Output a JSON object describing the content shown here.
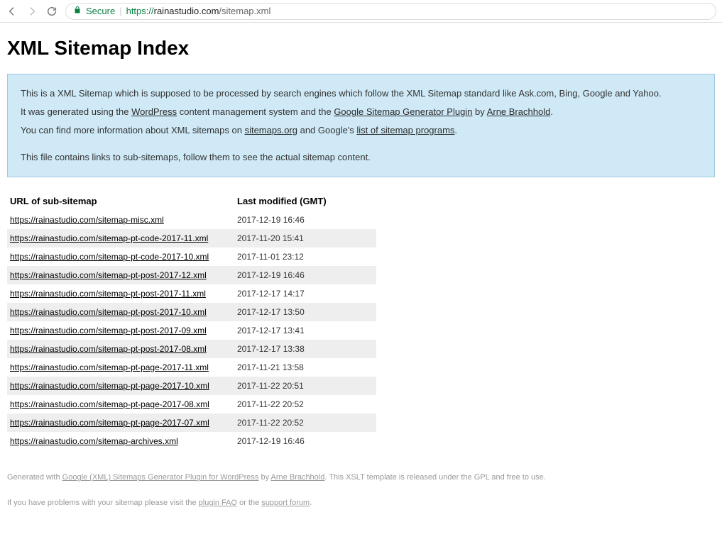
{
  "browser": {
    "secure_label": "Secure",
    "url_proto": "https://",
    "url_host": "rainastudio.com",
    "url_path": "/sitemap.xml"
  },
  "page_title": "XML Sitemap Index",
  "info": {
    "line1_a": "This is a XML Sitemap which is supposed to be processed by search engines which follow the XML Sitemap standard like Ask.com, Bing, Google and Yahoo.",
    "line2_a": "It was generated using the ",
    "line2_link1": "WordPress",
    "line2_b": " content management system and the ",
    "line2_link2": "Google Sitemap Generator Plugin",
    "line2_c": " by ",
    "line2_link3": "Arne Brachhold",
    "line2_d": ".",
    "line3_a": "You can find more information about XML sitemaps on ",
    "line3_link1": "sitemaps.org",
    "line3_b": " and Google's ",
    "line3_link2": "list of sitemap programs",
    "line3_c": ".",
    "line4": "This file contains links to sub-sitemaps, follow them to see the actual sitemap content."
  },
  "table": {
    "header_url": "URL of sub-sitemap",
    "header_date": "Last modified (GMT)",
    "rows": [
      {
        "url": "https://rainastudio.com/sitemap-misc.xml",
        "date": "2017-12-19 16:46"
      },
      {
        "url": "https://rainastudio.com/sitemap-pt-code-2017-11.xml",
        "date": "2017-11-20 15:41"
      },
      {
        "url": "https://rainastudio.com/sitemap-pt-code-2017-10.xml",
        "date": "2017-11-01 23:12"
      },
      {
        "url": "https://rainastudio.com/sitemap-pt-post-2017-12.xml",
        "date": "2017-12-19 16:46"
      },
      {
        "url": "https://rainastudio.com/sitemap-pt-post-2017-11.xml",
        "date": "2017-12-17 14:17"
      },
      {
        "url": "https://rainastudio.com/sitemap-pt-post-2017-10.xml",
        "date": "2017-12-17 13:50"
      },
      {
        "url": "https://rainastudio.com/sitemap-pt-post-2017-09.xml",
        "date": "2017-12-17 13:41"
      },
      {
        "url": "https://rainastudio.com/sitemap-pt-post-2017-08.xml",
        "date": "2017-12-17 13:38"
      },
      {
        "url": "https://rainastudio.com/sitemap-pt-page-2017-11.xml",
        "date": "2017-11-21 13:58"
      },
      {
        "url": "https://rainastudio.com/sitemap-pt-page-2017-10.xml",
        "date": "2017-11-22 20:51"
      },
      {
        "url": "https://rainastudio.com/sitemap-pt-page-2017-08.xml",
        "date": "2017-11-22 20:52"
      },
      {
        "url": "https://rainastudio.com/sitemap-pt-page-2017-07.xml",
        "date": "2017-11-22 20:52"
      },
      {
        "url": "https://rainastudio.com/sitemap-archives.xml",
        "date": "2017-12-19 16:46"
      }
    ]
  },
  "footer": {
    "gen_a": "Generated with ",
    "gen_link1": "Google (XML) Sitemaps Generator Plugin for WordPress",
    "gen_b": " by ",
    "gen_link2": "Arne Brachhold",
    "gen_c": ". This XSLT template is released under the GPL and free to use.",
    "prob_a": "If you have problems with your sitemap please visit the ",
    "prob_link1": "plugin FAQ",
    "prob_b": " or the ",
    "prob_link2": "support forum",
    "prob_c": "."
  }
}
